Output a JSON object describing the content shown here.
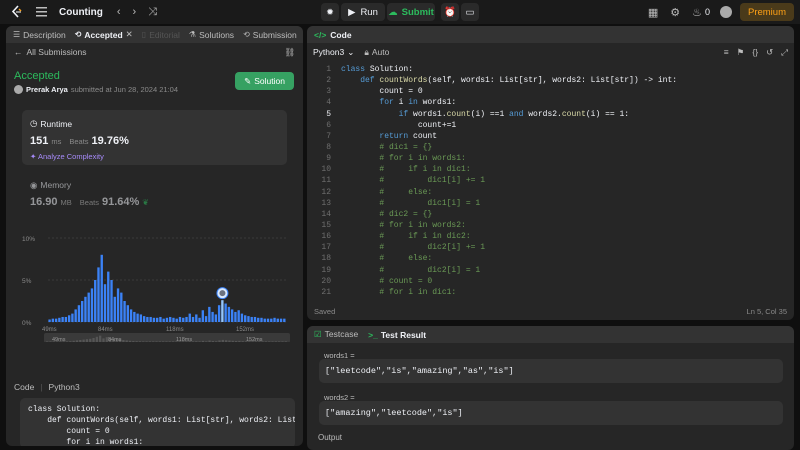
{
  "topbar": {
    "title": "Counting",
    "run_label": "Run",
    "submit_label": "Submit",
    "streak_count": "0",
    "premium_label": "Premium"
  },
  "left": {
    "tabs": [
      {
        "label": "Description"
      },
      {
        "label": "Accepted"
      },
      {
        "label": "Editorial"
      },
      {
        "label": "Solutions"
      },
      {
        "label": "Submission"
      }
    ],
    "back_label": "All Submissions",
    "status": "Accepted",
    "author": "Prerak Arya",
    "submitted_text": "submitted at Jun 28, 2024 21:04",
    "solution_button": "Solution",
    "runtime": {
      "label": "Runtime",
      "value": "151",
      "unit": "ms",
      "beats_label": "Beats",
      "beats_pct": "19.76%",
      "analyze": "Analyze Complexity"
    },
    "memory": {
      "label": "Memory",
      "value": "16.90",
      "unit": "MB",
      "beats_label": "Beats",
      "beats_pct": "91.64%"
    },
    "code_label": "Code",
    "code_lang": "Python3",
    "code_preview": [
      "class Solution:",
      "    def countWords(self, words1: List[str], words2: List[str",
      "        count = 0",
      "        for i in words1:"
    ]
  },
  "chart_data": {
    "type": "bar",
    "title": "",
    "xlabel": "",
    "ylabel": "",
    "y_tick_labels": [
      "10%",
      "5%",
      "0%"
    ],
    "ylim": [
      0,
      10
    ],
    "x_tick_labels": [
      "49ms",
      "84ms",
      "118ms",
      "152ms"
    ],
    "range_x_labels": [
      "49ms",
      "84ms",
      "118ms",
      "152ms"
    ],
    "highlight_x": "151ms",
    "values": [
      0.3,
      0.4,
      0.4,
      0.5,
      0.6,
      0.6,
      0.8,
      1.0,
      1.5,
      2.0,
      2.5,
      3.0,
      3.5,
      4.0,
      5.0,
      6.5,
      8.0,
      4.5,
      6.0,
      5.0,
      3.0,
      4.0,
      3.5,
      2.5,
      2.0,
      1.5,
      1.2,
      1.0,
      0.9,
      0.7,
      0.6,
      0.6,
      0.5,
      0.5,
      0.6,
      0.4,
      0.5,
      0.6,
      0.5,
      0.4,
      0.6,
      0.5,
      0.6,
      1.0,
      0.6,
      0.9,
      0.5,
      1.4,
      0.7,
      1.8,
      1.2,
      0.9,
      2.0,
      2.6,
      2.2,
      1.8,
      1.5,
      1.2,
      1.4,
      1.0,
      0.8,
      0.7,
      0.6,
      0.6,
      0.5,
      0.5,
      0.4,
      0.4,
      0.4,
      0.5,
      0.4,
      0.4,
      0.4
    ],
    "highlight_index": 53,
    "colors": {
      "bar": "#3b82f6",
      "highlight": "#93c5fd",
      "axis": "#6e6e6e"
    }
  },
  "editor": {
    "tab_label": "Code",
    "language": "Python3",
    "autosave": "Auto",
    "status_left": "Saved",
    "status_right": "Ln 5, Col 35",
    "lines": [
      "class Solution:",
      "    def countWords(self, words1: List[str], words2: List[str]) -> int:",
      "        count = 0",
      "        for i in words1:",
      "            if words1.count(i) ==1 and words2.count(i) == 1:",
      "                count+=1",
      "        return count",
      "        # dic1 = {}",
      "        # for i in words1:",
      "        #     if i in dic1:",
      "        #         dic1[i] += 1",
      "        #     else:",
      "        #         dic1[i] = 1",
      "        # dic2 = {}",
      "        # for i in words2:",
      "        #     if i in dic2:",
      "        #         dic2[i] += 1",
      "        #     else:",
      "        #         dic2[i] = 1",
      "        # count = 0",
      "        # for i in dic1:"
    ]
  },
  "testpanel": {
    "tab_testcase": "Testcase",
    "tab_result": "Test Result",
    "var1_label": "words1 =",
    "var1_value": "[\"leetcode\",\"is\",\"amazing\",\"as\",\"is\"]",
    "var2_label": "words2 =",
    "var2_value": "[\"amazing\",\"leetcode\",\"is\"]",
    "output_label": "Output"
  }
}
